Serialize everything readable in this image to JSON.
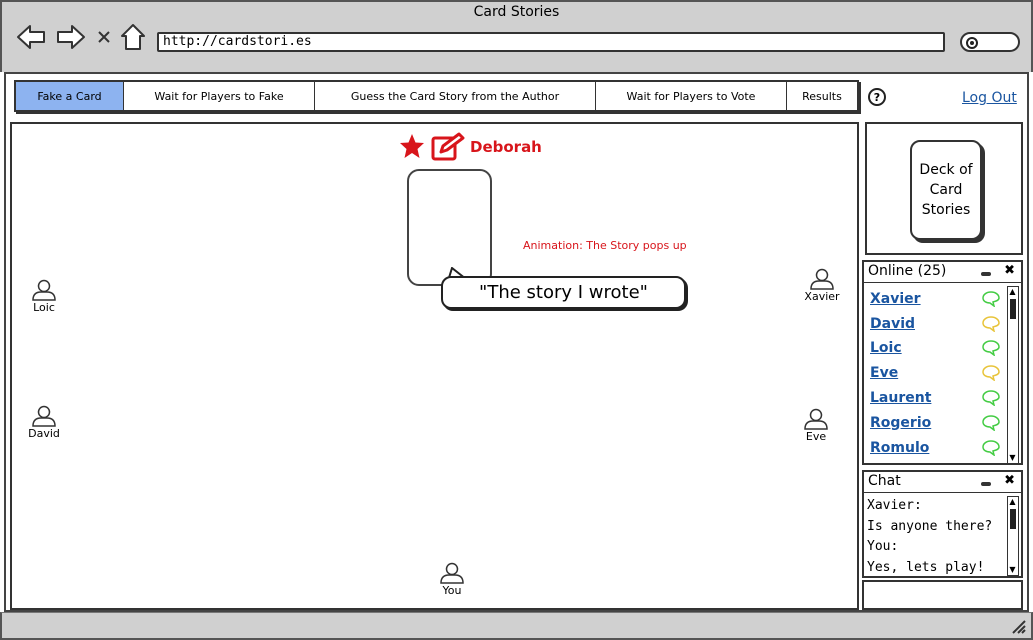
{
  "window": {
    "title": "Card Stories"
  },
  "browser": {
    "url": "http://cardstori.es"
  },
  "tabs": [
    {
      "label": "Fake a Card",
      "active": true
    },
    {
      "label": "Wait for Players to Fake",
      "active": false
    },
    {
      "label": "Guess the Card Story from the Author",
      "active": false
    },
    {
      "label": "Wait for Players to Vote",
      "active": false
    },
    {
      "label": "Results",
      "active": false
    }
  ],
  "header": {
    "help_glyph": "?",
    "logout_label": "Log Out"
  },
  "board": {
    "author": {
      "name": "Deborah",
      "icons": [
        "star-icon",
        "edit-icon"
      ],
      "color": "#d8151b"
    },
    "animation_note": "Animation: The Story pops up",
    "story_bubble": "\"The story I wrote\"",
    "players": [
      {
        "name": "Loic"
      },
      {
        "name": "David"
      },
      {
        "name": "Xavier"
      },
      {
        "name": "Eve"
      },
      {
        "name": "You"
      }
    ]
  },
  "deck": {
    "label_lines": [
      "Deck of",
      "Card",
      "Stories"
    ]
  },
  "online": {
    "title": "Online (25)",
    "users": [
      {
        "name": "Xavier",
        "status_color": "#44cc44"
      },
      {
        "name": "David",
        "status_color": "#e8c43a"
      },
      {
        "name": "Loic",
        "status_color": "#44cc44"
      },
      {
        "name": "Eve",
        "status_color": "#e8c43a"
      },
      {
        "name": "Laurent",
        "status_color": "#44cc44"
      },
      {
        "name": "Rogerio",
        "status_color": "#44cc44"
      },
      {
        "name": "Romulo",
        "status_color": "#44cc44"
      }
    ]
  },
  "chat": {
    "title": "Chat",
    "lines": [
      "Xavier:",
      "Is anyone there?",
      "You:",
      "Yes, lets play!"
    ]
  },
  "colors": {
    "active_tab": "#8db3f0",
    "link": "#1a55a0",
    "accent_red": "#d8151b"
  }
}
